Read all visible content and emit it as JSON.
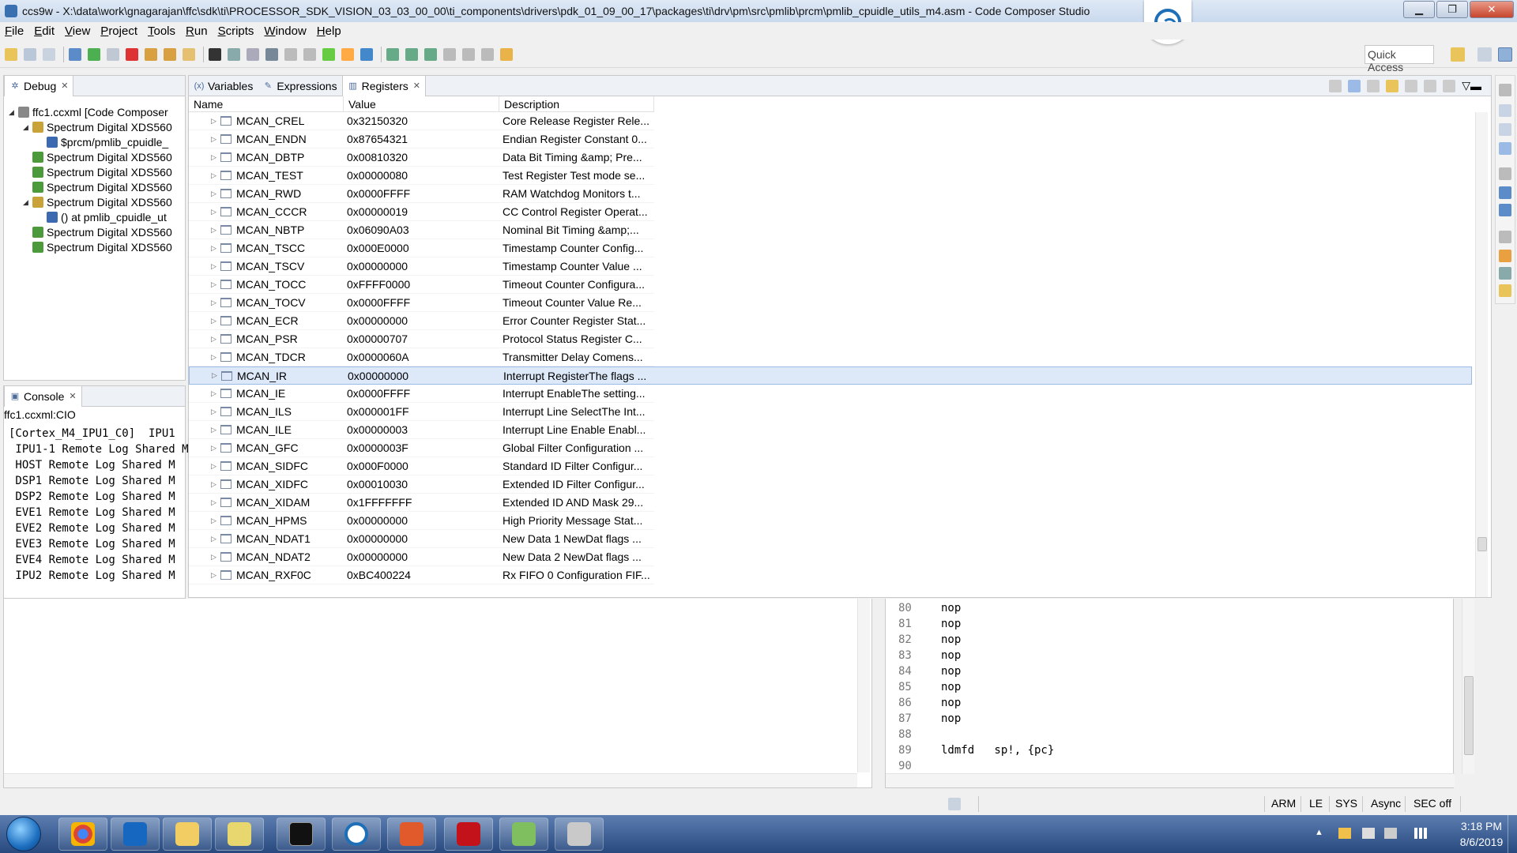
{
  "window": {
    "title": "ccs9w - X:\\data\\work\\gnagarajan\\ffc\\sdk\\ti\\PROCESSOR_SDK_VISION_03_03_00_00\\ti_components\\drivers\\pdk_01_09_00_17\\packages\\ti\\drv\\pm\\src\\pmlib\\prcm\\pmlib_cpuidle_utils_m4.asm - Code Composer Studio",
    "minimize": "▁",
    "restore": "❐",
    "close": "✕"
  },
  "menu": [
    "File",
    "Edit",
    "View",
    "Project",
    "Tools",
    "Run",
    "Scripts",
    "Window",
    "Help"
  ],
  "toolbar": {
    "quick_access": "Quick Access"
  },
  "debug_panel": {
    "tab": "Debug",
    "tree": [
      {
        "label": "ffc1.ccxml [Code Composer",
        "level": 0,
        "expanded": true,
        "icon": "target-config-icon"
      },
      {
        "label": "Spectrum Digital XDS560",
        "level": 1,
        "expanded": true,
        "icon": "suspended-core-icon"
      },
      {
        "label": "$prcm/pmlib_cpuidle_",
        "level": 2,
        "expanded": null,
        "icon": "stack-frame-icon"
      },
      {
        "label": "Spectrum Digital XDS560",
        "level": 1,
        "expanded": null,
        "icon": "core-icon"
      },
      {
        "label": "Spectrum Digital XDS560",
        "level": 1,
        "expanded": null,
        "icon": "core-icon"
      },
      {
        "label": "Spectrum Digital XDS560",
        "level": 1,
        "expanded": null,
        "icon": "core-icon"
      },
      {
        "label": "Spectrum Digital XDS560",
        "level": 1,
        "expanded": true,
        "icon": "suspended-core-icon"
      },
      {
        "label": "() at pmlib_cpuidle_ut",
        "level": 2,
        "expanded": null,
        "icon": "stack-frame-icon"
      },
      {
        "label": "Spectrum Digital XDS560",
        "level": 1,
        "expanded": null,
        "icon": "core-icon"
      },
      {
        "label": "Spectrum Digital XDS560",
        "level": 1,
        "expanded": null,
        "icon": "core-icon"
      }
    ]
  },
  "console_panel": {
    "tab": "Console",
    "subtitle": "ffc1.ccxml:CIO",
    "lines": [
      "[Cortex_M4_IPU1_C0]  IPU1",
      " IPU1-1 Remote Log Shared M",
      " HOST Remote Log Shared M",
      " DSP1 Remote Log Shared M",
      " DSP2 Remote Log Shared M",
      " EVE1 Remote Log Shared M",
      " EVE2 Remote Log Shared M",
      " EVE3 Remote Log Shared M",
      " EVE4 Remote Log Shared M",
      " IPU2 Remote Log Shared M"
    ]
  },
  "registers_panel": {
    "tabs": [
      {
        "label": "Variables",
        "icon": "variables-icon"
      },
      {
        "label": "Expressions",
        "icon": "expressions-icon"
      },
      {
        "label": "Registers",
        "icon": "registers-icon",
        "active": true
      }
    ],
    "columns": [
      "Name",
      "Value",
      "Description"
    ],
    "rows": [
      {
        "name": "MCAN_CREL",
        "value": "0x32150320",
        "desc": "Core Release Register Rele..."
      },
      {
        "name": "MCAN_ENDN",
        "value": "0x87654321",
        "desc": "Endian Register Constant 0..."
      },
      {
        "name": "MCAN_DBTP",
        "value": "0x00810320",
        "desc": "Data Bit Timing &amp; Pre..."
      },
      {
        "name": "MCAN_TEST",
        "value": "0x00000080",
        "desc": "Test Register Test mode se..."
      },
      {
        "name": "MCAN_RWD",
        "value": "0x0000FFFF",
        "desc": "RAM Watchdog Monitors t..."
      },
      {
        "name": "MCAN_CCCR",
        "value": "0x00000019",
        "desc": "CC Control Register Operat..."
      },
      {
        "name": "MCAN_NBTP",
        "value": "0x06090A03",
        "desc": "Nominal Bit Timing &amp;..."
      },
      {
        "name": "MCAN_TSCC",
        "value": "0x000E0000",
        "desc": "Timestamp Counter Config..."
      },
      {
        "name": "MCAN_TSCV",
        "value": "0x00000000",
        "desc": "Timestamp Counter Value ..."
      },
      {
        "name": "MCAN_TOCC",
        "value": "0xFFFF0000",
        "desc": "Timeout Counter Configura..."
      },
      {
        "name": "MCAN_TOCV",
        "value": "0x0000FFFF",
        "desc": "Timeout Counter Value Re..."
      },
      {
        "name": "MCAN_ECR",
        "value": "0x00000000",
        "desc": "Error Counter Register Stat..."
      },
      {
        "name": "MCAN_PSR",
        "value": "0x00000707",
        "desc": "Protocol Status Register C..."
      },
      {
        "name": "MCAN_TDCR",
        "value": "0x0000060A",
        "desc": "Transmitter Delay Comens..."
      },
      {
        "name": "MCAN_IR",
        "value": "0x00000000",
        "desc": "Interrupt RegisterThe flags ...",
        "selected": true
      },
      {
        "name": "MCAN_IE",
        "value": "0x0000FFFF",
        "desc": "Interrupt EnableThe setting..."
      },
      {
        "name": "MCAN_ILS",
        "value": "0x000001FF",
        "desc": "Interrupt Line SelectThe Int..."
      },
      {
        "name": "MCAN_ILE",
        "value": "0x00000003",
        "desc": "Interrupt Line Enable Enabl..."
      },
      {
        "name": "MCAN_GFC",
        "value": "0x0000003F",
        "desc": "Global Filter Configuration ..."
      },
      {
        "name": "MCAN_SIDFC",
        "value": "0x000F0000",
        "desc": "Standard ID Filter Configur..."
      },
      {
        "name": "MCAN_XIDFC",
        "value": "0x00010030",
        "desc": "Extended ID Filter Configur..."
      },
      {
        "name": "MCAN_XIDAM",
        "value": "0x1FFFFFFF",
        "desc": "Extended ID AND Mask 29..."
      },
      {
        "name": "MCAN_HPMS",
        "value": "0x00000000",
        "desc": "High Priority Message Stat..."
      },
      {
        "name": "MCAN_NDAT1",
        "value": "0x00000000",
        "desc": "New Data 1 NewDat flags ..."
      },
      {
        "name": "MCAN_NDAT2",
        "value": "0x00000000",
        "desc": "New Data 2 NewDat flags ..."
      },
      {
        "name": "MCAN_RXF0C",
        "value": "0xBC400224",
        "desc": "Rx FIFO 0 Configuration FIF..."
      }
    ]
  },
  "editor": {
    "lines": [
      {
        "no": "80",
        "code": "nop"
      },
      {
        "no": "81",
        "code": "nop"
      },
      {
        "no": "82",
        "code": "nop"
      },
      {
        "no": "83",
        "code": "nop"
      },
      {
        "no": "84",
        "code": "nop"
      },
      {
        "no": "85",
        "code": "nop"
      },
      {
        "no": "86",
        "code": "nop"
      },
      {
        "no": "87",
        "code": "nop"
      },
      {
        "no": "88",
        "code": ""
      },
      {
        "no": "89",
        "code": "ldmfd   sp!, {pc}"
      },
      {
        "no": "90",
        "code": ""
      }
    ]
  },
  "status_bar": [
    "ARM",
    "LE",
    "SYS",
    "Async",
    "SEC off"
  ],
  "taskbar": {
    "apps": [
      "chrome-icon",
      "outlook-icon",
      "explorer-icon",
      "notepad-icon",
      "cmd-icon",
      "ccs-icon",
      "can-tool-icon",
      "acrobat-icon",
      "paint-icon",
      "virtualbox-icon"
    ],
    "time": "3:18 PM",
    "date": "8/6/2019"
  },
  "colors": {
    "accent": "#1e6fb8",
    "selection": "#dde9f9",
    "taskbar": "#27497e"
  }
}
